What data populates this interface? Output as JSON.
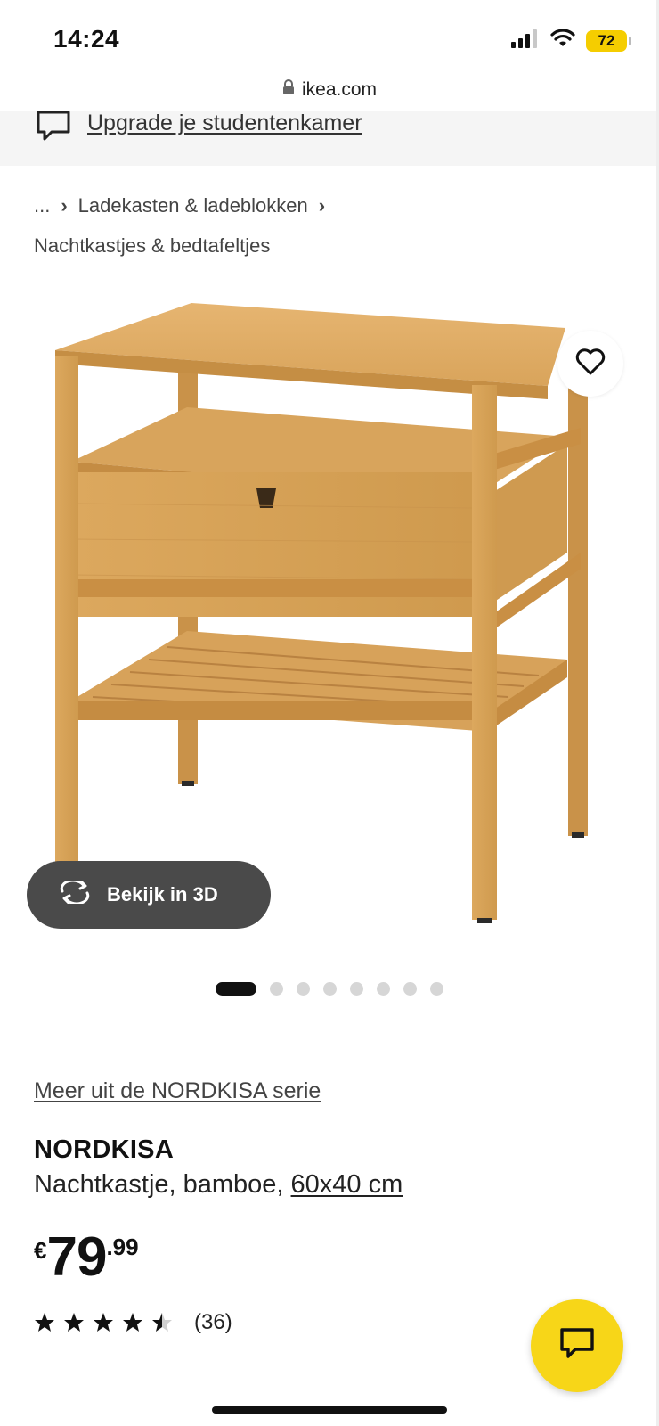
{
  "status_bar": {
    "time": "14:24",
    "battery": "72"
  },
  "browser": {
    "url": "ikea.com"
  },
  "promo": {
    "link_text": "Upgrade je studentenkamer"
  },
  "breadcrumb": {
    "ellipsis": "...",
    "level1": "Ladekasten & ladeblokken",
    "level2": "Nachtkastjes & bedtafeltjes"
  },
  "gallery": {
    "view_3d_label": "Bekijk in 3D",
    "image_count": 8,
    "active_index": 0
  },
  "product": {
    "series_link": "Meer uit de NORDKISA serie",
    "name": "NORDKISA",
    "description": "Nachtkastje, bamboe,",
    "size": "60x40 cm",
    "price_currency": "€",
    "price_integer": "79",
    "price_decimal": ".99",
    "rating": 4.5,
    "rating_max": 5,
    "rating_count": "(36)"
  },
  "colors": {
    "accent_yellow": "#f7d618",
    "button_dark": "#4a4a4a",
    "bamboo": "#d9a257"
  },
  "icons": [
    "signal-icon",
    "wifi-icon",
    "battery-icon",
    "lock-icon",
    "chat-bubble-icon",
    "heart-icon",
    "rotate-3d-icon",
    "star-icon",
    "chat-icon"
  ]
}
